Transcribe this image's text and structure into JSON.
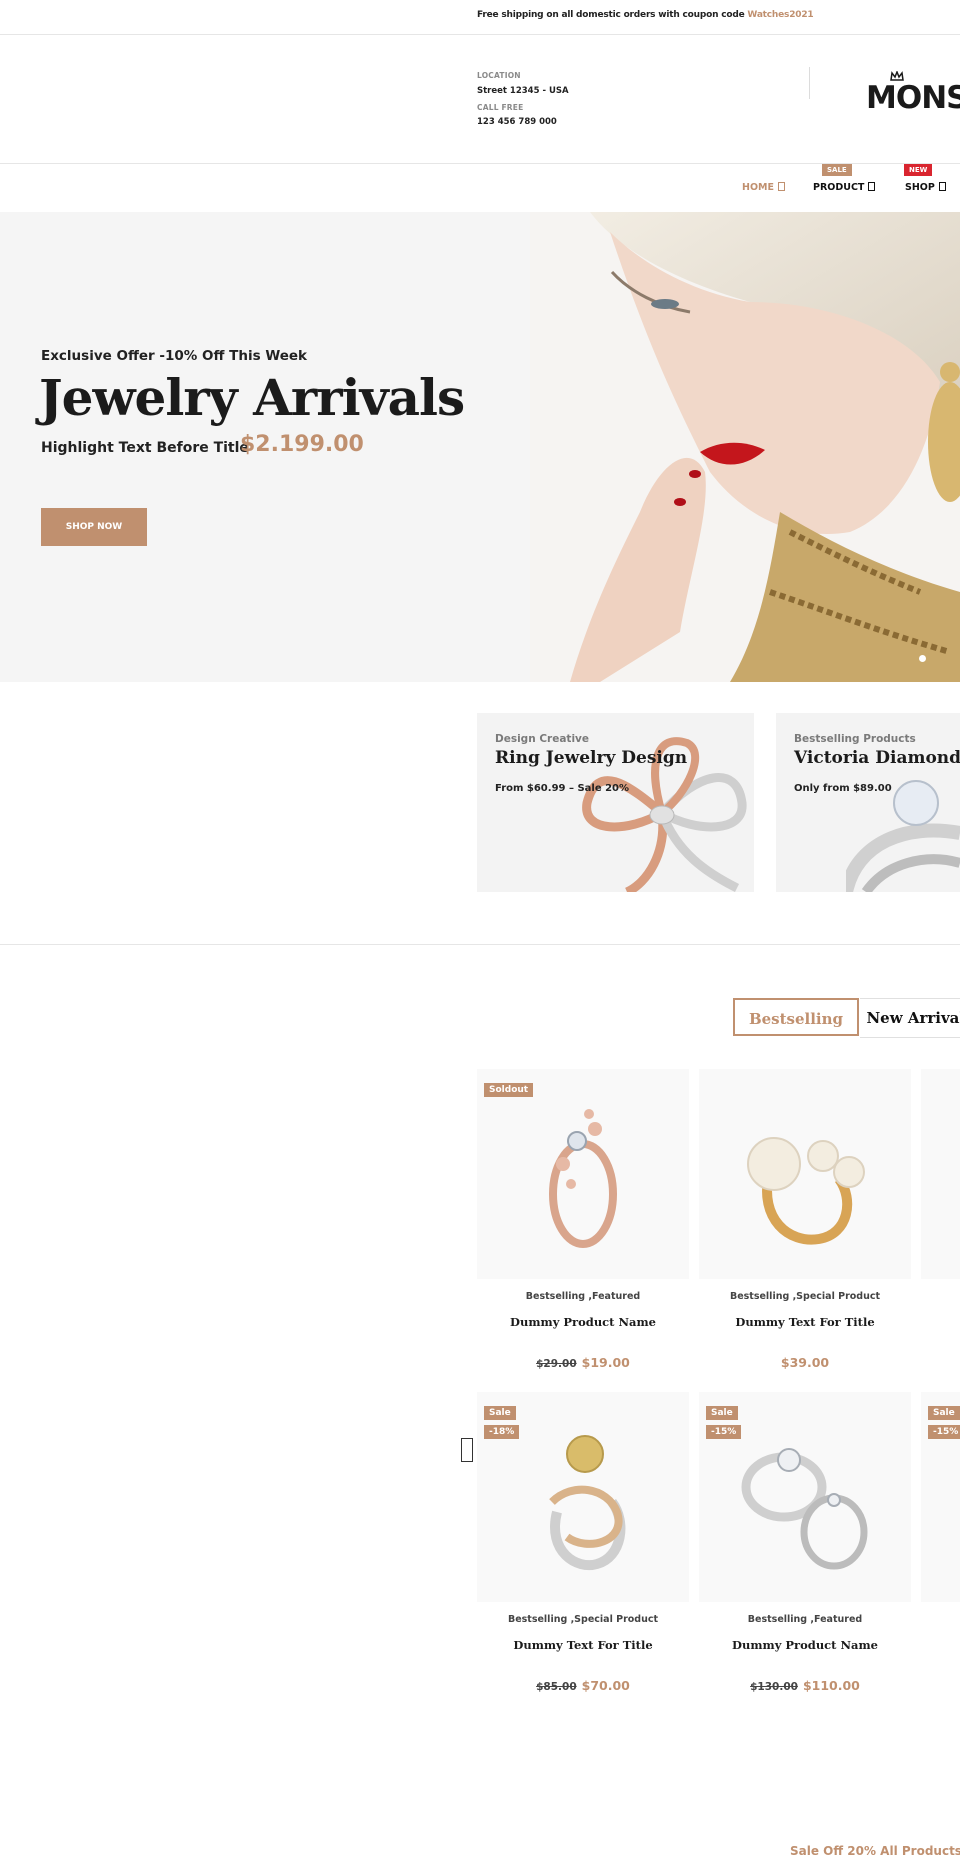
{
  "topbar": {
    "text": "Free shipping on all domestic orders with coupon code ",
    "code": "Watches2021"
  },
  "header": {
    "location_label": "LOCATION",
    "location_value": "Street 12345 - USA",
    "call_label": "CALL FREE",
    "call_value": "123 456 789 000",
    "logo": "MONSTA"
  },
  "nav": {
    "items": [
      {
        "label": "HOME",
        "badge": ""
      },
      {
        "label": "PRODUCT",
        "badge": "SALE"
      },
      {
        "label": "SHOP",
        "badge": "NEW"
      }
    ]
  },
  "hero": {
    "kicker": "Exclusive Offer -10% Off This Week",
    "title": "Jewelry Arrivals",
    "highlight": "Highlight Text Before Title",
    "price": "$2.199.00",
    "button": "SHOP NOW"
  },
  "banners": [
    {
      "subtitle": "Design Creative",
      "title": "Ring Jewelry Design",
      "desc": "From $60.99 – Sale 20%"
    },
    {
      "subtitle": "Bestselling Products",
      "title": "Victoria Diamonds",
      "desc": "Only from $89.00"
    }
  ],
  "tabs": {
    "active": "Bestselling",
    "inactive": "New Arrivals"
  },
  "products": [
    {
      "badges": [
        "Soldout"
      ],
      "category": "Bestselling ,Featured",
      "name": "Dummy Product Name",
      "old_price": "$29.00",
      "price": "$19.00"
    },
    {
      "badges": [],
      "category": "Bestselling ,Special Product",
      "name": "Dummy Text For Title",
      "old_price": "",
      "price": "$39.00"
    },
    {
      "badges": [
        "Sale",
        "-18%"
      ],
      "category": "Bestselling ,Special Product",
      "name": "Dummy Text For Title",
      "old_price": "$85.00",
      "price": "$70.00"
    },
    {
      "badges": [
        "Sale",
        "-15%"
      ],
      "category": "Bestselling ,Featured",
      "name": "Dummy Product Name",
      "old_price": "$130.00",
      "price": "$110.00"
    },
    {
      "badges": [
        "Sale",
        "-15%"
      ]
    }
  ],
  "promo": "Sale Off 20% All Products",
  "colors": {
    "accent": "#c0906f",
    "new_badge": "#d9252f"
  }
}
